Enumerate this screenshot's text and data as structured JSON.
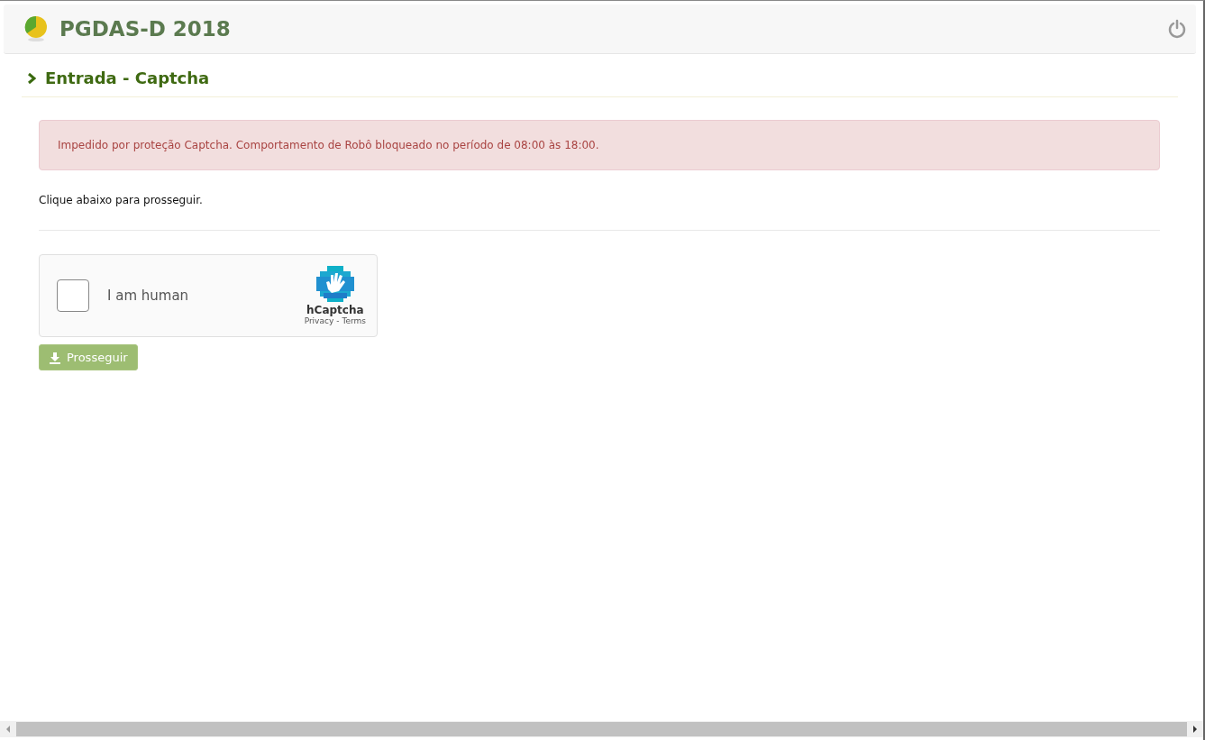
{
  "header": {
    "title": "PGDAS-D 2018"
  },
  "section": {
    "title": "Entrada - Captcha"
  },
  "alert": {
    "message": "Impedido por proteção Captcha. Comportamento de Robô bloqueado no período de 08:00 às 18:00."
  },
  "instruction": "Clique abaixo para prosseguir.",
  "captcha": {
    "label": "I am human",
    "checked": false,
    "brand": "hCaptcha",
    "privacy": "Privacy",
    "separator": "-",
    "terms": "Terms"
  },
  "button": {
    "label": "Prosseguir",
    "disabled": true
  }
}
